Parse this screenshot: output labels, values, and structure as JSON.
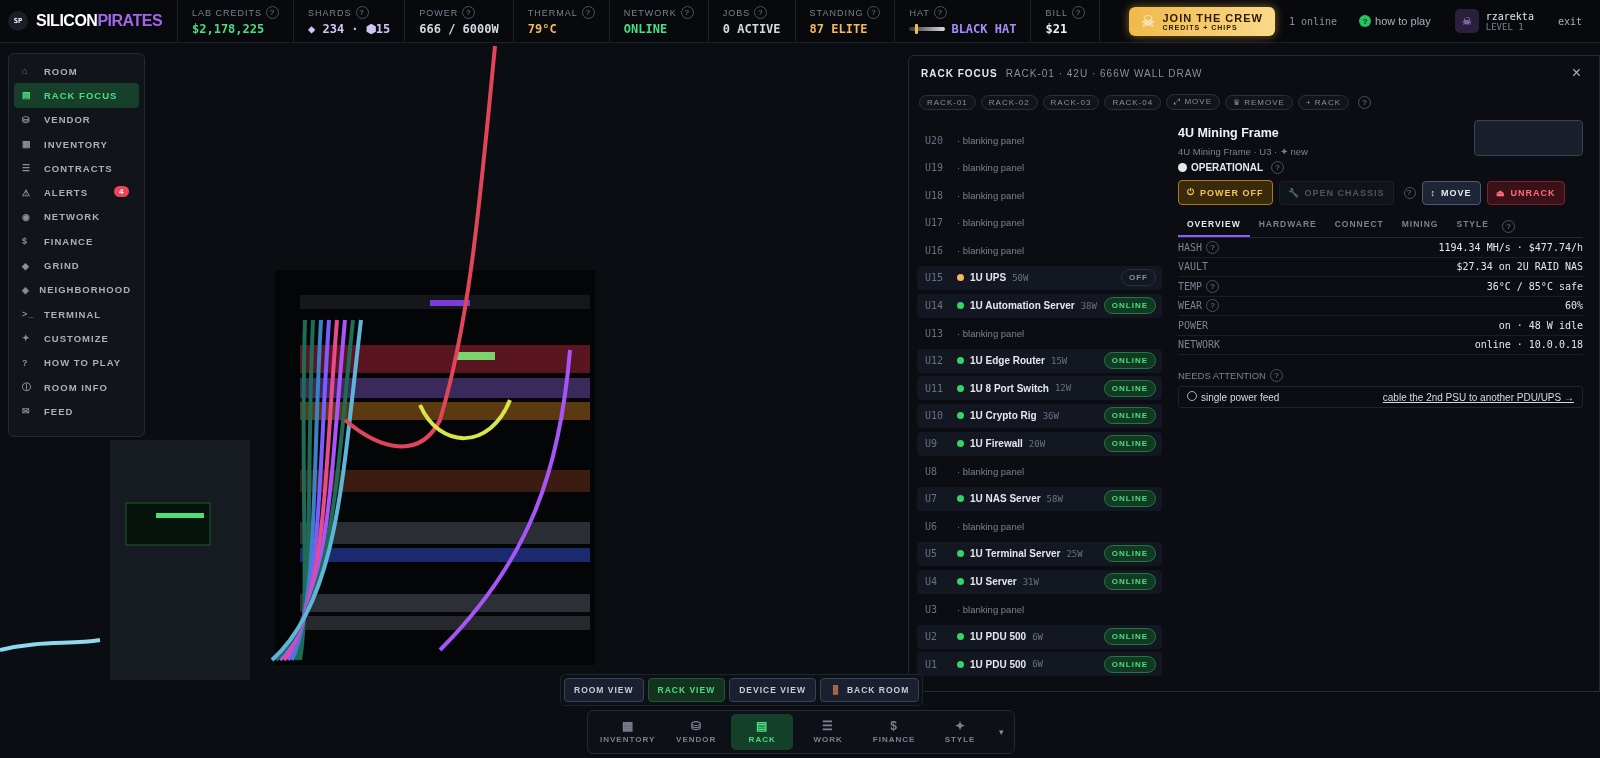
{
  "topbar": {
    "logo_text": "SP",
    "brand_part_1": "SILICON",
    "brand_part_2": "PIRATES",
    "stats": [
      {
        "kind": "value",
        "label": "LAB CREDITS",
        "help": "?",
        "value": "$2,178,225",
        "color": "#4ade80"
      },
      {
        "kind": "value",
        "label": "SHARDS",
        "help": "?",
        "value": "◆ 234 · ⬢15",
        "color": "#cfc6f5"
      },
      {
        "kind": "value",
        "label": "POWER",
        "help": "?",
        "value": "666 / 6000W",
        "color": "#d6d9e0"
      },
      {
        "kind": "value",
        "label": "THERMAL",
        "help": "?",
        "value": "79°C",
        "color": "#f5b85a"
      },
      {
        "kind": "value",
        "label": "NETWORK",
        "help": "?",
        "value": "ONLINE",
        "color": "#4ade80"
      },
      {
        "kind": "value",
        "label": "JOBS",
        "help": "?",
        "value": "0 ACTIVE",
        "color": "#d6d9e0"
      },
      {
        "kind": "value",
        "label": "STANDING",
        "help": "?",
        "value": "87 ELITE",
        "color": "#f5b85a"
      },
      {
        "kind": "slider",
        "label": "HAT",
        "help": "?",
        "value": "BLACK HAT",
        "color": "#a78bfa",
        "level": 0.15
      },
      {
        "kind": "value",
        "label": "BILL",
        "help": "?",
        "value": "$21",
        "color": "#f1f3f6"
      }
    ],
    "join": {
      "icon": "☠",
      "title": "JOIN THE CREW",
      "subtitle": "CREDITS + CHIPS"
    },
    "online": "1 online",
    "help_icon": "?",
    "help_label": "how to play",
    "user": {
      "avatar": "☠",
      "name": "rzarekta",
      "level": "LEVEL 1"
    },
    "exit": "exit"
  },
  "nav": {
    "items": [
      {
        "icon": "⌂",
        "label": "ROOM",
        "selected": false
      },
      {
        "icon": "▤",
        "label": "RACK FOCUS",
        "selected": true
      },
      {
        "icon": "⛁",
        "label": "VENDOR",
        "selected": false
      },
      {
        "icon": "▦",
        "label": "INVENTORY",
        "selected": false
      },
      {
        "icon": "☰",
        "label": "CONTRACTS",
        "selected": false
      },
      {
        "icon": "⚠",
        "label": "ALERTS",
        "selected": false,
        "badge": "4"
      },
      {
        "icon": "◉",
        "label": "NETWORK",
        "selected": false
      },
      {
        "icon": "$",
        "label": "FINANCE",
        "selected": false
      },
      {
        "icon": "◆",
        "label": "GRIND",
        "selected": false
      },
      {
        "icon": "◈",
        "label": "NEIGHBORHOOD",
        "selected": false
      },
      {
        "icon": ">_",
        "label": "TERMINAL",
        "selected": false
      },
      {
        "icon": "✦",
        "label": "CUSTOMIZE",
        "selected": false
      },
      {
        "icon": "?",
        "label": "HOW TO PLAY",
        "selected": false
      },
      {
        "icon": "ⓘ",
        "label": "ROOM INFO",
        "selected": false
      },
      {
        "icon": "✉",
        "label": "FEED",
        "selected": false
      }
    ]
  },
  "rack_panel": {
    "title": "RACK FOCUS",
    "subtitle": "RACK-01 · 42U · 666W WALL DRAW",
    "close": "×",
    "racks": [
      "RACK-01",
      "RACK-02",
      "RACK-03",
      "RACK-04"
    ],
    "actions": [
      "⤢ MOVE",
      "♛ REMOVE",
      "+ RACK"
    ],
    "help": "?",
    "slots": [
      {
        "unit": "U20",
        "kind": "blank",
        "label": "· blanking panel"
      },
      {
        "unit": "U19",
        "kind": "blank",
        "label": "· blanking panel"
      },
      {
        "unit": "U18",
        "kind": "blank",
        "label": "· blanking panel"
      },
      {
        "unit": "U17",
        "kind": "blank",
        "label": "· blanking panel"
      },
      {
        "unit": "U16",
        "kind": "blank",
        "label": "· blanking panel"
      },
      {
        "unit": "U15",
        "kind": "device",
        "label": "1U UPS",
        "watts": "50W",
        "status": "OFF",
        "on": false,
        "color": "#f5b85a"
      },
      {
        "unit": "U14",
        "kind": "device",
        "label": "1U Automation Server",
        "watts": "38W",
        "status": "ONLINE",
        "on": true,
        "color": "#34d46a"
      },
      {
        "unit": "U13",
        "kind": "blank",
        "label": "· blanking panel"
      },
      {
        "unit": "U12",
        "kind": "device",
        "label": "1U Edge Router",
        "watts": "15W",
        "status": "ONLINE",
        "on": true,
        "color": "#34d46a"
      },
      {
        "unit": "U11",
        "kind": "device",
        "label": "1U 8 Port Switch",
        "watts": "12W",
        "status": "ONLINE",
        "on": true,
        "color": "#34d46a"
      },
      {
        "unit": "U10",
        "kind": "device",
        "label": "1U Crypto Rig",
        "watts": "36W",
        "status": "ONLINE",
        "on": true,
        "color": "#34d46a"
      },
      {
        "unit": "U9",
        "kind": "device",
        "label": "1U Firewall",
        "watts": "20W",
        "status": "ONLINE",
        "on": true,
        "color": "#34d46a"
      },
      {
        "unit": "U8",
        "kind": "blank",
        "label": "· blanking panel"
      },
      {
        "unit": "U7",
        "kind": "device",
        "label": "1U NAS Server",
        "watts": "58W",
        "status": "ONLINE",
        "on": true,
        "color": "#34d46a"
      },
      {
        "unit": "U6",
        "kind": "blank",
        "label": "· blanking panel"
      },
      {
        "unit": "U5",
        "kind": "device",
        "label": "1U Terminal Server",
        "watts": "25W",
        "status": "ONLINE",
        "on": true,
        "color": "#34d46a"
      },
      {
        "unit": "U4",
        "kind": "device",
        "label": "1U Server",
        "watts": "31W",
        "status": "ONLINE",
        "on": true,
        "color": "#34d46a"
      },
      {
        "unit": "U3",
        "kind": "blank",
        "label": "· blanking panel"
      },
      {
        "unit": "U2",
        "kind": "device",
        "label": "1U PDU 500",
        "watts": "6W",
        "status": "ONLINE",
        "on": true,
        "color": "#34d46a"
      },
      {
        "unit": "U1",
        "kind": "device",
        "label": "1U PDU 500",
        "watts": "6W",
        "status": "ONLINE",
        "on": true,
        "color": "#34d46a"
      }
    ],
    "detail": {
      "title": "4U Mining Frame",
      "subtitle": "4U Mining Frame · U3 · ✦ new",
      "state": "OPERATIONAL",
      "state_help": "?",
      "buttons": [
        {
          "kind": "warning",
          "icon": "⏻",
          "label": "POWER OFF",
          "disabled": false
        },
        {
          "kind": "neutral",
          "icon": "🔧",
          "label": "OPEN CHASSIS",
          "disabled": true
        },
        {
          "kind": "help",
          "label": "?",
          "disabled": false
        },
        {
          "kind": "primary",
          "icon": "↕",
          "label": "MOVE",
          "disabled": false
        },
        {
          "kind": "danger",
          "icon": "⏏",
          "label": "UNRACK",
          "disabled": false
        }
      ],
      "tabs": [
        {
          "label": "OVERVIEW",
          "selected": true
        },
        {
          "label": "HARDWARE",
          "selected": false
        },
        {
          "label": "CONNECT",
          "selected": false
        },
        {
          "label": "MINING",
          "selected": false
        },
        {
          "label": "STYLE",
          "selected": false
        }
      ],
      "tabs_help": "?",
      "stats": [
        {
          "label": "HASH",
          "help": "?",
          "value": "1194.34 MH/s · $477.74/h"
        },
        {
          "label": "VAULT",
          "value": "$27.34 on 2U RAID NAS"
        },
        {
          "label": "TEMP",
          "help": "?",
          "value": "36°C / 85°C safe"
        },
        {
          "label": "WEAR",
          "help": "?",
          "value": "60%"
        },
        {
          "label": "POWER",
          "value": "on · 48 W idle"
        },
        {
          "label": "NETWORK",
          "value": "online · 10.0.0.18"
        }
      ],
      "attention": {
        "title": "NEEDS ATTENTION",
        "help": "?",
        "items": [
          {
            "text": "single power feed",
            "checked": false,
            "link": "cable the 2nd PSU to another PDU/UPS →"
          }
        ]
      }
    }
  },
  "view_switch": [
    {
      "label": "ROOM VIEW",
      "selected": false
    },
    {
      "label": "RACK VIEW",
      "selected": true
    },
    {
      "label": "DEVICE VIEW",
      "selected": false
    },
    {
      "label": "BACK ROOM",
      "selected": false,
      "icon": "🚪"
    }
  ],
  "dock": {
    "items": [
      {
        "icon": "▦",
        "label": "INVENTORY",
        "selected": false
      },
      {
        "icon": "⛁",
        "label": "VENDOR",
        "selected": false
      },
      {
        "icon": "▤",
        "label": "RACK",
        "selected": true
      },
      {
        "icon": "☰",
        "label": "WORK",
        "selected": false
      },
      {
        "icon": "$",
        "label": "FINANCE",
        "selected": false
      },
      {
        "icon": "✦",
        "label": "STYLE",
        "selected": false
      }
    ],
    "more": "▾"
  }
}
